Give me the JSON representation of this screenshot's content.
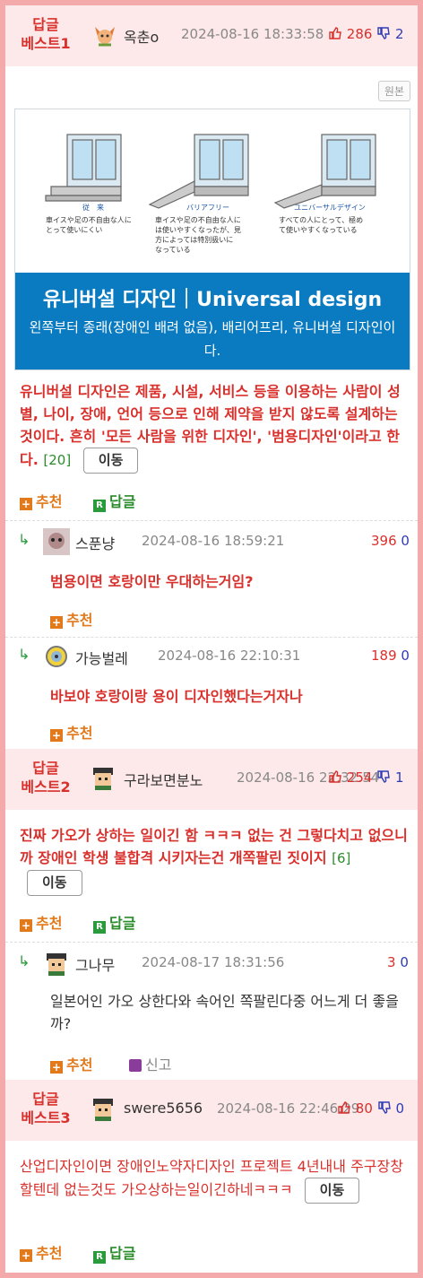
{
  "original_button": "원본",
  "move_button": "이동",
  "recommend_label": "추천",
  "reply_label": "답글",
  "report_label": "신고",
  "best1": {
    "label": "답글\n베스트1",
    "nick": "옥춘o",
    "date": "2024-08-16 18:33:58",
    "up": "286",
    "down": "2",
    "image": {
      "col1_label": "従　来",
      "col1_desc": "車イスや足の不自由な人に\nとって使いにくい",
      "col2_label": "バリアフリー",
      "col2_desc": "車イスや足の不自由な人に\nは使いやすくなったが、見\n方によっては特別扱いに\nなっている",
      "col3_label": "ユニバーサルデザイン",
      "col3_desc": "すべての人にとって、極め\nて使いやすくなっている",
      "title": "유니버설 디자인｜Universal design",
      "subtitle": "왼쪽부터 종래(장애인 배려 없음), 배리어프리, 유니버설 디자인이다."
    },
    "text": "유니버설 디자인은 제품, 시설, 서비스 등을 이용하는 사람이 성별, 나이, 장애, 언어 등으로 인해 제약을 받지 않도록 설계하는 것이다. 흔히 '모든 사람을 위한 디자인', '범용디자인'이라고 한다.",
    "count": "[20]"
  },
  "reply1": {
    "nick": "스푼냥",
    "date": "2024-08-16 18:59:21",
    "up": "396",
    "down": "0",
    "text": "범용이면 호랑이만 우대하는거임?"
  },
  "reply2": {
    "nick": "가능벌레",
    "date": "2024-08-16 22:10:31",
    "up": "189",
    "down": "0",
    "text": "바보야 호랑이랑 용이 디자인했다는거자나"
  },
  "best2": {
    "label": "답글\n베스트2",
    "nick": "구라보면분노",
    "date": "2024-08-16 22:32:54",
    "up": "254",
    "down": "1",
    "text": "진짜 가오가 상하는 일이긴 함 ㅋㅋㅋ 없는 건 그렇다치고 없으니까 장애인 학생 불합격 시키자는건 개쪽팔린 짓이지",
    "count": "[6]"
  },
  "reply3": {
    "nick": "그나무",
    "date": "2024-08-17 18:31:56",
    "up": "3",
    "down": "0",
    "text": "일본어인 가오 상한다와 속어인 쪽팔린다중 어느게 더 좋을까?"
  },
  "best3": {
    "label": "답글\n베스트3",
    "nick": "swere5656",
    "date": "2024-08-16 22:46:29",
    "up": "80",
    "down": "0",
    "text": "산업디자인이면 장애인노약자디자인 프로젝트 4년내내 주구장창 할텐데 없는것도 가오상하는일이긴하네ㅋㅋㅋ"
  },
  "colors": {
    "frame": "#f4a9aa",
    "best_bg": "#fde9ea",
    "accent_red": "#d9302c",
    "blue": "#2e3cb5",
    "orange": "#e2791b",
    "green": "#2a8c2a",
    "image_blue": "#0a7bc1"
  },
  "icons": [
    "thumbs-up-icon",
    "thumbs-down-icon",
    "reply-arrow-icon",
    "plus-icon",
    "r-reply-icon",
    "report-icon"
  ]
}
